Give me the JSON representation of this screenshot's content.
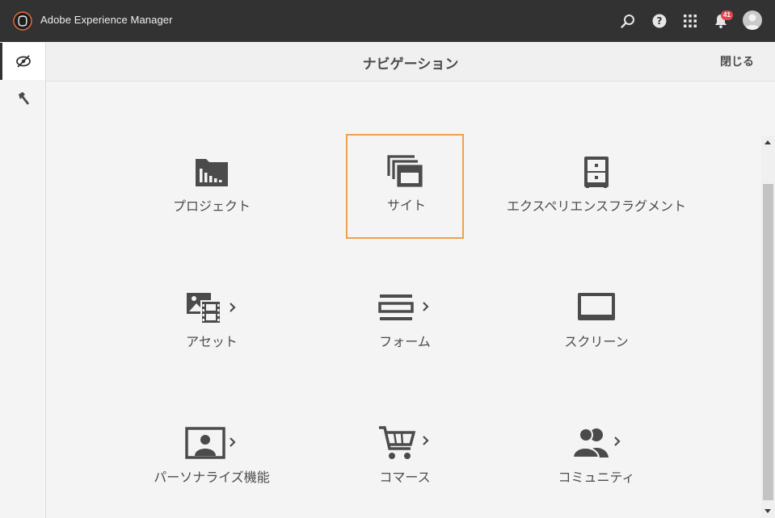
{
  "app": {
    "title": "Adobe Experience Manager"
  },
  "topbar": {
    "notification_count": "41",
    "icons": [
      "search-icon",
      "help-icon",
      "solutions-grid-icon",
      "notification-bell-icon",
      "user-avatar"
    ]
  },
  "rail": {
    "items": [
      {
        "icon": "navigation-compass-icon",
        "active": true
      },
      {
        "icon": "tools-hammer-icon",
        "active": false
      }
    ]
  },
  "panel": {
    "title": "ナビゲーション",
    "close_label": "閉じる"
  },
  "tiles": [
    {
      "label": "プロジェクト",
      "icon": "projects-folder-icon",
      "has_children": false,
      "selected": false
    },
    {
      "label": "サイト",
      "icon": "sites-pages-icon",
      "has_children": false,
      "selected": true
    },
    {
      "label": "エクスペリエンスフラグメント",
      "icon": "experience-fragments-cabinet-icon",
      "has_children": false,
      "selected": false
    },
    {
      "label": "アセット",
      "icon": "assets-image-film-icon",
      "has_children": true,
      "selected": false
    },
    {
      "label": "フォーム",
      "icon": "forms-lines-icon",
      "has_children": true,
      "selected": false
    },
    {
      "label": "スクリーン",
      "icon": "screens-monitor-icon",
      "has_children": false,
      "selected": false
    },
    {
      "label": "パーソナライズ機能",
      "icon": "personalization-profile-icon",
      "has_children": true,
      "selected": false
    },
    {
      "label": "コマース",
      "icon": "commerce-cart-icon",
      "has_children": true,
      "selected": false
    },
    {
      "label": "コミュニティ",
      "icon": "communities-users-icon",
      "has_children": true,
      "selected": false
    }
  ],
  "colors": {
    "topbar_bg": "#323232",
    "selected_outline": "#eea14f",
    "badge_bg": "#e34850",
    "icon_color": "#4b4b4b"
  }
}
